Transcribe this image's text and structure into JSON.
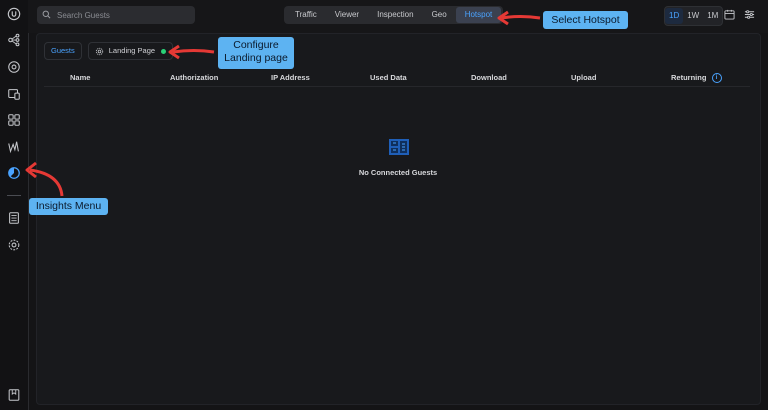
{
  "search": {
    "placeholder": "Search Guests"
  },
  "tabs": [
    {
      "label": "Traffic",
      "active": false
    },
    {
      "label": "Viewer",
      "active": false
    },
    {
      "label": "Inspection",
      "active": false
    },
    {
      "label": "Geo",
      "active": false
    },
    {
      "label": "Hotspot",
      "active": true
    }
  ],
  "period": [
    {
      "label": "1D",
      "active": true
    },
    {
      "label": "1W",
      "active": false
    },
    {
      "label": "1M",
      "active": false
    }
  ],
  "subtabs": {
    "guests": "Guests",
    "landing": "Landing Page"
  },
  "columns": [
    "Name",
    "Authorization",
    "IP Address",
    "Used Data",
    "Download",
    "Upload",
    "Returning"
  ],
  "empty": {
    "message": "No Connected Guests"
  },
  "callouts": {
    "hotspot": "Select Hotspot",
    "landing_line1": "Configure",
    "landing_line2": "Landing page",
    "insights": "Insights Menu"
  },
  "colors": {
    "accent": "#4aa3ff",
    "callout_bg": "#5db3f2",
    "arrow": "#e53935",
    "status_online": "#2ad177"
  },
  "sidebar_icons": [
    "logo-icon",
    "topology-icon",
    "target-icon",
    "devices-icon",
    "clients-grid-icon",
    "stats-icon",
    "insights-icon",
    "logs-icon",
    "settings-icon",
    "whats-new-icon"
  ]
}
